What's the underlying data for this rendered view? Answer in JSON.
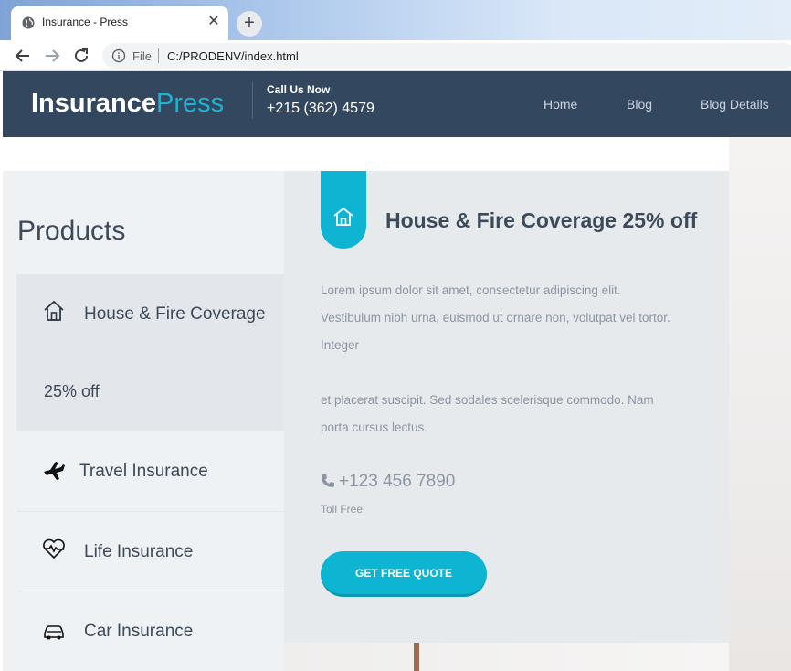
{
  "browser": {
    "tab_title": "Insurance - Press",
    "tab_close": "✕",
    "new_tab": "+",
    "scheme": "File",
    "url": "C:/PRODENV/index.html"
  },
  "header": {
    "logo_bold": "Insurance",
    "logo_light": "Press",
    "call_label": "Call Us Now",
    "call_phone": "+215 (362) 4579",
    "nav": [
      "Home",
      "Blog",
      "Blog Details"
    ]
  },
  "sidebar": {
    "title": "Products",
    "items": [
      {
        "label": "House & Fire Coverage",
        "sub": "25% off",
        "icon": "house-icon"
      },
      {
        "label": "Travel Insurance",
        "icon": "airplane-icon"
      },
      {
        "label": "Life Insurance",
        "icon": "heartbeat-icon"
      },
      {
        "label": "Car Insurance",
        "icon": "car-icon"
      }
    ]
  },
  "panel": {
    "title": "House & Fire Coverage 25% off",
    "paragraph1_line1": "Lorem ipsum dolor sit amet, consectetur adipiscing elit.",
    "paragraph1_line2": "Vestibulum nibh urna, euismod ut ornare non, volutpat vel tortor.",
    "paragraph1_line3": "Integer",
    "paragraph2_line1": "et placerat suscipit. Sed sodales scelerisque commodo. Nam",
    "paragraph2_line2": "porta cursus lectus.",
    "phone": "+123 456 7890",
    "tollfree": "Toll Free",
    "button": "GET FREE QUOTE"
  },
  "colors": {
    "header_bg": "#33475e",
    "accent": "#0db5d3",
    "sidebar_bg": "#eff2f5",
    "panel_bg": "#e6eaed"
  }
}
